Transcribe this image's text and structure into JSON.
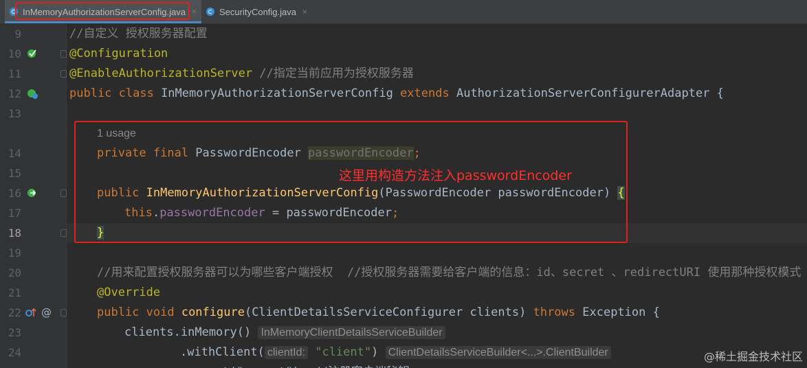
{
  "tabs": [
    {
      "label": "InMemoryAuthorizationServerConfig.java",
      "active": true,
      "icon": "java-class-icon"
    },
    {
      "label": "SecurityConfig.java",
      "active": false,
      "icon": "java-class-icon"
    }
  ],
  "tab_close_glyph": "×",
  "lines": [
    {
      "num": "9",
      "comment": "//自定义 授权服务器配置"
    },
    {
      "num": "10",
      "annotation": "@Configuration"
    },
    {
      "num": "11",
      "annotation": "@EnableAuthorizationServer",
      "comment": " //指定当前应用为授权服务器"
    },
    {
      "num": "12",
      "kw1": "public class ",
      "cls": "InMemoryAuthorizationServerConfig ",
      "kw2": "extends ",
      "rest": "AuthorizationServerConfigurerAdapter {"
    },
    {
      "num": "13"
    },
    {
      "usage_hint": "1 usage"
    },
    {
      "num": "14",
      "kw": "private final ",
      "type": "PasswordEncoder ",
      "field": "passwordEncoder",
      "semi": ";"
    },
    {
      "num": "15"
    },
    {
      "num": "16",
      "kw": "public ",
      "fn": "InMemoryAuthorizationServerConfig",
      "params": "(PasswordEncoder passwordEncoder) ",
      "brace": "{"
    },
    {
      "num": "17",
      "kw": "this",
      "dot": ".",
      "field": "passwordEncoder",
      "rest": " = passwordEncoder",
      "semi": ";"
    },
    {
      "num": "18",
      "brace": "}"
    },
    {
      "num": "19"
    },
    {
      "num": "20",
      "comment": "//用来配置授权服务器可以为哪些客户端授权  //授权服务器需要给客户端的信息：id、secret 、redirectURI 使用那种授权模式"
    },
    {
      "num": "21",
      "annotation": "@Override"
    },
    {
      "num": "22",
      "kw": "public void ",
      "fn": "configure",
      "params": "(ClientDetailsServiceConfigurer clients) ",
      "kw2": "throws ",
      "rest": "Exception {"
    },
    {
      "num": "23",
      "code": "clients.inMemory()",
      "inlay": "InMemoryClientDetailsServiceBuilder"
    },
    {
      "num": "24",
      "code1": ".withClient(",
      "param_hint": "clientId:",
      "str": "\"client\"",
      "code2": ")",
      "inlay": "ClientDetailsServiceBuilder<...>.ClientBuilder"
    },
    {
      "partial": ".secret(\"secret\")  //注册客户端秘钥"
    }
  ],
  "annotation_note": "这里用构造方法注入passwordEncoder",
  "watermark": "@稀土掘金技术社区",
  "colors": {
    "background": "#2b2b2b",
    "keyword": "#cc7832",
    "annotation": "#bbb529",
    "comment": "#808080",
    "field": "#9876aa",
    "string": "#6a8759",
    "method": "#ffc66d",
    "highlight_box": "#e0221f"
  }
}
